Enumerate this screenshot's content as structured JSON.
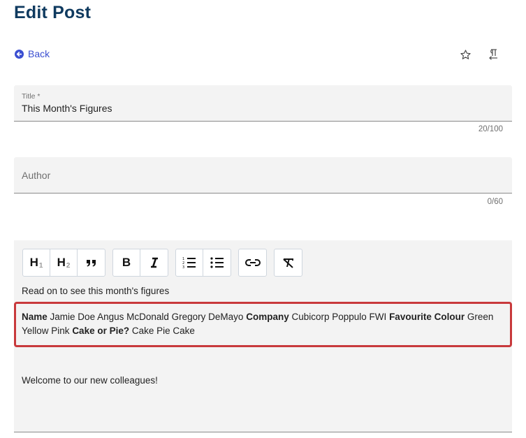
{
  "page": {
    "title": "Edit Post"
  },
  "nav": {
    "back_label": "Back"
  },
  "top_actions": [
    {
      "name": "favorite",
      "icon": "star-outline-icon"
    },
    {
      "name": "text-direction",
      "icon": "pilcrow-rtl-icon"
    }
  ],
  "fields": {
    "title": {
      "label": "Title *",
      "value": "This Month's Figures",
      "counter": "20/100"
    },
    "author": {
      "placeholder": "Author",
      "value": "",
      "counter": "0/60"
    }
  },
  "editor": {
    "toolbar": [
      {
        "group": "block",
        "buttons": [
          "heading-1",
          "heading-2",
          "blockquote"
        ]
      },
      {
        "group": "inline",
        "buttons": [
          "bold",
          "italic"
        ]
      },
      {
        "group": "lists",
        "buttons": [
          "ordered-list",
          "bullet-list"
        ]
      },
      {
        "group": "link",
        "buttons": [
          "link"
        ]
      },
      {
        "group": "clear",
        "buttons": [
          "clear-formatting"
        ]
      }
    ],
    "toolbar_labels": {
      "h1": "H",
      "h1_sub": "1",
      "h2": "H",
      "h2_sub": "2",
      "bold": "B",
      "italic": "I"
    },
    "intro": "Read on to see this month's figures",
    "table_block": {
      "cols": [
        {
          "header": "Name",
          "values": "Jamie Doe Angus McDonald Gregory DeMayo"
        },
        {
          "header": "Company",
          "values": "Cubicorp Poppulo FWI"
        },
        {
          "header": "Favourite Colour",
          "values": "Green Yellow Pink"
        },
        {
          "header": "Cake or Pie?",
          "values": "Cake Pie Cake"
        }
      ],
      "highlight_color": "#c8393c"
    },
    "closing": "Welcome to our new colleagues!"
  },
  "colors": {
    "title": "#0f3a5f",
    "link": "#3b4fd1",
    "field_bg": "#f3f3f3"
  }
}
